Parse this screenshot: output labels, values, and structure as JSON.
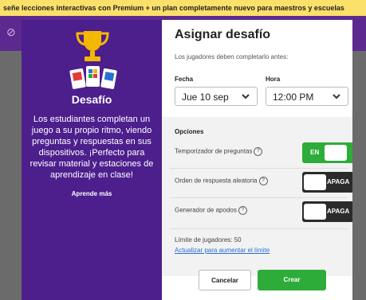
{
  "banner": {
    "text": "señe lecciones interactivas con Premium + un plan completamente nuevo para maestros y escuelas"
  },
  "left_panel": {
    "title": "Desafío",
    "description": "Los estudiantes completan un juego a su propio ritmo, viendo preguntas y respuestas en sus dispositivos. ¡Perfecto para revisar material y estaciones de aprendizaje en clase!",
    "link": "Aprende más",
    "trophy_icon": "trophy-icon",
    "cards_icon": "game-cards-icon",
    "colors": {
      "panel": "#4d1f8d",
      "trophy": "#f5b800"
    }
  },
  "dialog": {
    "title": "Asignar desafío",
    "subtitle": "Los jugadores deben completarlo antes:",
    "date": {
      "label": "Fecha",
      "value": "Jue 10 sep"
    },
    "time": {
      "label": "Hora",
      "value": "12:00 PM"
    },
    "options": {
      "title": "Opciones",
      "items": [
        {
          "label": "Temporizador de preguntas",
          "state": "EN",
          "on": true
        },
        {
          "label": "Orden de respuesta aleatoria",
          "state": "APAGA",
          "on": false
        },
        {
          "label": "Generador de apodos",
          "state": "APAGA",
          "on": false
        }
      ],
      "limit_text": "Límite de jugadores: 50",
      "limit_link": "Actualizar para aumentar el límite"
    },
    "buttons": {
      "cancel": "Cancelar",
      "create": "Crear"
    },
    "colors": {
      "accent": "#2eac3a",
      "link": "#2a6fd6",
      "toggle_off": "#2b2b2b"
    }
  }
}
